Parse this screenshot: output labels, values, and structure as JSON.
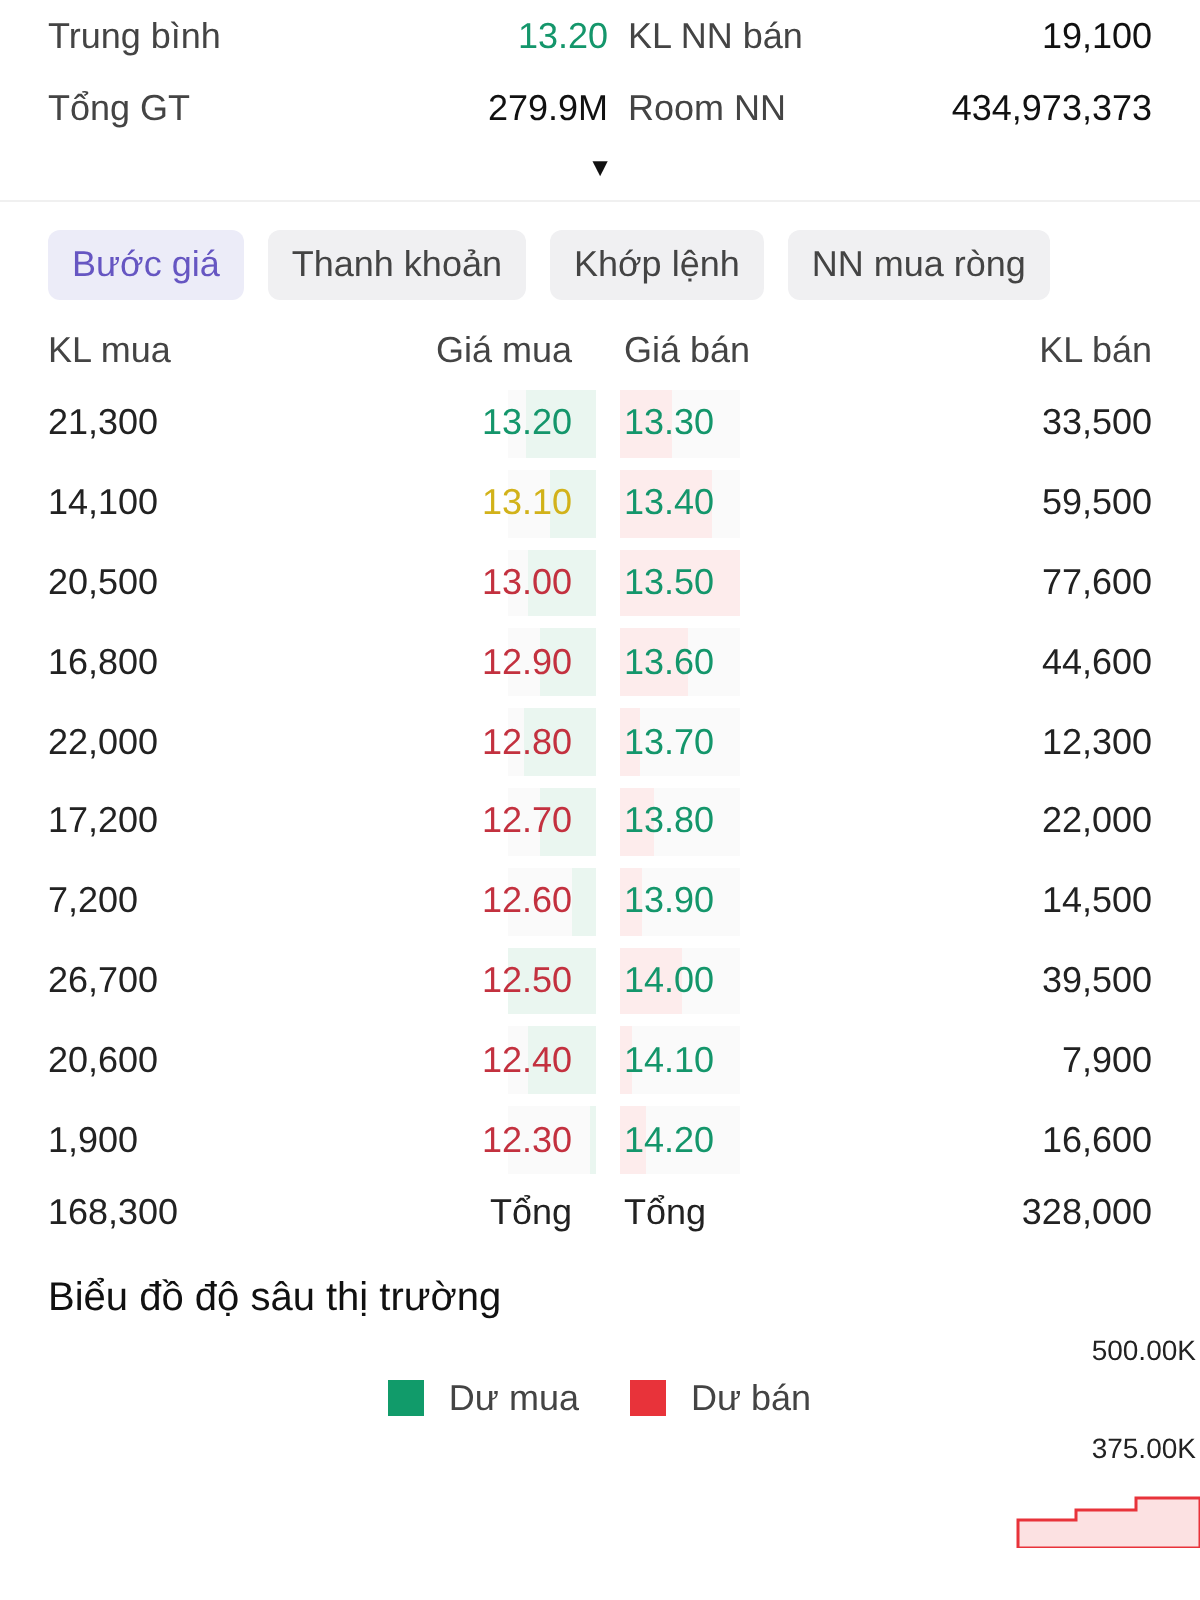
{
  "summary": [
    {
      "label": "Trung bình",
      "value": {
        "text": "13.20",
        "kind": "up"
      },
      "label2": "KL NN bán",
      "value2": "19,100"
    },
    {
      "label": "Tổng GT",
      "value": {
        "text": "279.9M",
        "kind": "plain"
      },
      "label2": "Room NN",
      "value2": "434,973,373"
    }
  ],
  "expand_toggle": "▼",
  "tabs": [
    {
      "label": "Bước giá",
      "selected": true
    },
    {
      "label": "Thanh khoản",
      "selected": false
    },
    {
      "label": "Khớp lệnh",
      "selected": false
    },
    {
      "label": "NN mua ròng",
      "selected": false
    }
  ],
  "order_book": {
    "columns": [
      "KL mua",
      "Giá mua",
      "Giá bán",
      "KL bán"
    ],
    "rows": [
      {
        "buy_volume": "21,300",
        "buy_price": {
          "text": "13.20",
          "kind": "up"
        },
        "buy_bar": {
          "level": 0.8
        },
        "sell_bar": {
          "level": 0.43
        },
        "sell_price": {
          "text": "13.30",
          "kind": "up"
        },
        "sell_volume": "33,500"
      },
      {
        "buy_volume": "14,100",
        "buy_price": {
          "text": "13.10",
          "kind": "ref"
        },
        "buy_bar": {
          "level": 0.53
        },
        "sell_bar": {
          "level": 0.77
        },
        "sell_price": {
          "text": "13.40",
          "kind": "up"
        },
        "sell_volume": "59,500"
      },
      {
        "buy_volume": "20,500",
        "buy_price": {
          "text": "13.00",
          "kind": "down"
        },
        "buy_bar": {
          "level": 0.77
        },
        "sell_bar": {
          "level": 1
        },
        "sell_price": {
          "text": "13.50",
          "kind": "up"
        },
        "sell_volume": "77,600"
      },
      {
        "buy_volume": "16,800",
        "buy_price": {
          "text": "12.90",
          "kind": "down"
        },
        "buy_bar": {
          "level": 0.63
        },
        "sell_bar": {
          "level": 0.57
        },
        "sell_price": {
          "text": "13.60",
          "kind": "up"
        },
        "sell_volume": "44,600"
      },
      {
        "buy_volume": "22,000",
        "buy_price": {
          "text": "12.80",
          "kind": "down"
        },
        "buy_bar": {
          "level": 0.82
        },
        "sell_bar": {
          "level": 0.16
        },
        "sell_price": {
          "text": "13.70",
          "kind": "up"
        },
        "sell_volume": "12,300"
      },
      {
        "buy_volume": "17,200",
        "buy_price": {
          "text": "12.70",
          "kind": "down"
        },
        "buy_bar": {
          "level": 0.64
        },
        "sell_bar": {
          "level": 0.28
        },
        "sell_price": {
          "text": "13.80",
          "kind": "up"
        },
        "sell_volume": "22,000"
      },
      {
        "buy_volume": "7,200",
        "buy_price": {
          "text": "12.60",
          "kind": "down"
        },
        "buy_bar": {
          "level": 0.27
        },
        "sell_bar": {
          "level": 0.19
        },
        "sell_price": {
          "text": "13.90",
          "kind": "up"
        },
        "sell_volume": "14,500"
      },
      {
        "buy_volume": "26,700",
        "buy_price": {
          "text": "12.50",
          "kind": "down"
        },
        "buy_bar": {
          "level": 1
        },
        "sell_bar": {
          "level": 0.51
        },
        "sell_price": {
          "text": "14.00",
          "kind": "up"
        },
        "sell_volume": "39,500"
      },
      {
        "buy_volume": "20,600",
        "buy_price": {
          "text": "12.40",
          "kind": "down"
        },
        "buy_bar": {
          "level": 0.77
        },
        "sell_bar": {
          "level": 0.1
        },
        "sell_price": {
          "text": "14.10",
          "kind": "up"
        },
        "sell_volume": "7,900"
      },
      {
        "buy_volume": "1,900",
        "buy_price": {
          "text": "12.30",
          "kind": "down"
        },
        "buy_bar": {
          "level": 0.07
        },
        "sell_bar": {
          "level": 0.21
        },
        "sell_price": {
          "text": "14.20",
          "kind": "up"
        },
        "sell_volume": "16,600"
      }
    ],
    "total": {
      "buy_volume": "168,300",
      "buy_label": "Tổng",
      "sell_label": "Tổng",
      "sell_volume": "328,000"
    }
  },
  "depth_chart": {
    "title": "Biểu đồ độ sâu thị trường",
    "legend": [
      {
        "label": "Dư mua",
        "color": "#119b6a"
      },
      {
        "label": "Dư bán",
        "color": "#e8333a"
      }
    ],
    "y_labels": [
      "500.00K",
      "375.00K"
    ]
  }
}
